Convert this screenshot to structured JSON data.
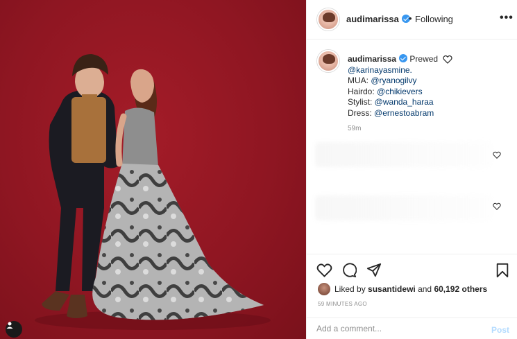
{
  "post": {
    "author": "audimarissa",
    "follow_status": "Following",
    "more_label": "•••",
    "separator": "•"
  },
  "caption": {
    "username": "audimarissa",
    "text_first": "Prewed",
    "lines": [
      {
        "label": "",
        "mention": "@karinayasmine."
      },
      {
        "label": "MUA: ",
        "mention": "@ryanogilvy"
      },
      {
        "label": "Hairdo: ",
        "mention": "@chikievers"
      },
      {
        "label": "Stylist: ",
        "mention": "@wanda_haraa"
      },
      {
        "label": "Dress: ",
        "mention": "@ernestoabram"
      }
    ],
    "time": "59m"
  },
  "likes": {
    "prefix": "Liked by ",
    "user": "susantidewi",
    "middle": " and ",
    "count": "60,192 others"
  },
  "timestamp": "59 MINUTES AGO",
  "comment_box": {
    "placeholder": "Add a comment...",
    "post_label": "Post"
  },
  "icons": {
    "like": "heart-icon",
    "comment": "comment-icon",
    "share": "share-icon",
    "save": "bookmark-icon",
    "more": "more-icon",
    "verified": "verified-badge-icon",
    "tag": "user-tag-icon"
  },
  "colors": {
    "background_red": "#8f1622",
    "mention": "#00376b",
    "verified": "#3897f0",
    "post_button": "#b3dbff"
  }
}
